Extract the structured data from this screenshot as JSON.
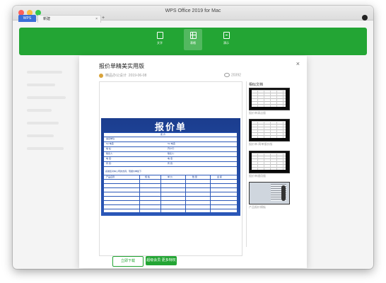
{
  "window": {
    "title": "WPS Office 2019 for Mac",
    "tabs": [
      {
        "label": "WPS"
      },
      {
        "label": "新建"
      }
    ],
    "new_tab_symbol": "+",
    "close_symbol": "×"
  },
  "doc_types": [
    {
      "label": "文字",
      "icon": "doc-icon",
      "active": false
    },
    {
      "label": "表格",
      "icon": "spreadsheet-icon",
      "active": true
    },
    {
      "label": "演示",
      "icon": "presentation-icon",
      "active": false
    }
  ],
  "template": {
    "title": "报价单精美实用版",
    "author": "精品办公设计",
    "date": "2019-06-08",
    "views": "20392",
    "close_symbol": "×",
    "preview": {
      "sheet_title": "报价单",
      "header_col": "卖 方 ",
      "rows": [
        {
          "left": "发货单位:",
          "right": ""
        },
        {
          "left": "Tel 电话:",
          "right": "Tel 电话:"
        },
        {
          "left": "地 址:",
          "right": "开户行:"
        },
        {
          "left": "联系人:",
          "right": "联系人:"
        },
        {
          "left": "电 话:",
          "right": "电 话:"
        },
        {
          "left": "传 真:",
          "right": "传 真:"
        }
      ],
      "note": "感谢您对本公司的支持，现报价单如下:",
      "table_headers": [
        "产品名称",
        "规 格",
        "单 价",
        "数 量",
        "金 额"
      ]
    }
  },
  "similar": {
    "title": "相似文档",
    "items": [
      {
        "caption": "报价单清洁版"
      },
      {
        "caption": "报价单-简单报价版"
      },
      {
        "caption": "报价单通用版"
      },
      {
        "caption": "产品报价模板"
      }
    ]
  },
  "buttons": {
    "download": "立即下载",
    "vip": "超级会员 更多特权"
  },
  "colors": {
    "accent": "#23a534",
    "sheet_blue": "#1b3d8e"
  }
}
